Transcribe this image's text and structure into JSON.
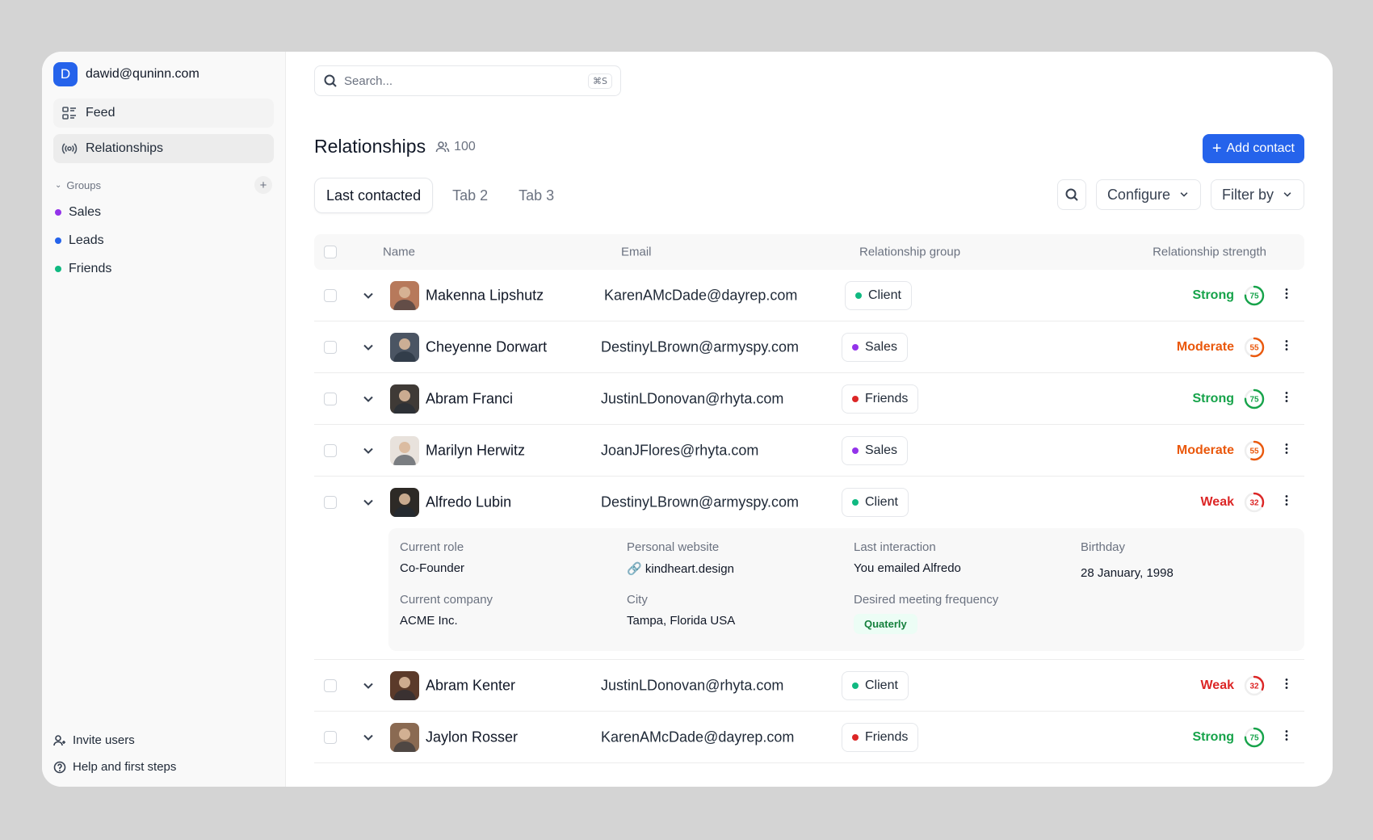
{
  "account": {
    "initial": "D",
    "email": "dawid@quninn.com"
  },
  "nav": [
    {
      "label": "Feed",
      "icon": "feed-icon"
    },
    {
      "label": "Relationships",
      "icon": "broadcast-icon"
    }
  ],
  "groups": {
    "title": "Groups",
    "items": [
      {
        "label": "Sales",
        "color": "#9333ea"
      },
      {
        "label": "Leads",
        "color": "#2563eb"
      },
      {
        "label": "Friends",
        "color": "#10b981"
      }
    ]
  },
  "footer": {
    "invite": "Invite users",
    "help": "Help and first steps"
  },
  "search": {
    "placeholder": "Search...",
    "shortcut": "⌘S"
  },
  "page": {
    "title": "Relationships",
    "count": "100",
    "add_button": "Add contact"
  },
  "tabs": [
    "Last contacted",
    "Tab 2",
    "Tab 3"
  ],
  "toolbar": {
    "configure": "Configure",
    "filter": "Filter by"
  },
  "columns": {
    "name": "Name",
    "email": "Email",
    "group": "Relationship group",
    "strength": "Relationship strength"
  },
  "colors": {
    "accent": "#2563eb",
    "strong": "#16a34a",
    "moderate": "#ea580c",
    "weak": "#dc2626"
  },
  "rows": [
    {
      "name": "Makenna Lipshutz",
      "email": "KarenAMcDade@dayrep.com",
      "group": "Client",
      "group_color": "#10b981",
      "strength": "Strong",
      "score": "75",
      "level": 0.75,
      "color": "#16a34a"
    },
    {
      "name": "Cheyenne Dorwart",
      "email": "DestinyLBrown@armyspy.com",
      "group": "Sales",
      "group_color": "#9333ea",
      "strength": "Moderate",
      "score": "55",
      "level": 0.55,
      "color": "#ea580c"
    },
    {
      "name": "Abram Franci",
      "email": "JustinLDonovan@rhyta.com",
      "group": "Friends",
      "group_color": "#dc2626",
      "strength": "Strong",
      "score": "75",
      "level": 0.75,
      "color": "#16a34a"
    },
    {
      "name": "Marilyn Herwitz",
      "email": "JoanJFlores@rhyta.com",
      "group": "Sales",
      "group_color": "#9333ea",
      "strength": "Moderate",
      "score": "55",
      "level": 0.55,
      "color": "#ea580c"
    },
    {
      "name": "Alfredo Lubin",
      "email": "DestinyLBrown@armyspy.com",
      "group": "Client",
      "group_color": "#10b981",
      "strength": "Weak",
      "score": "32",
      "level": 0.32,
      "color": "#dc2626"
    },
    {
      "name": "Abram Kenter",
      "email": "JustinLDonovan@rhyta.com",
      "group": "Client",
      "group_color": "#10b981",
      "strength": "Weak",
      "score": "32",
      "level": 0.32,
      "color": "#dc2626"
    },
    {
      "name": "Jaylon Rosser",
      "email": "KarenAMcDade@dayrep.com",
      "group": "Friends",
      "group_color": "#dc2626",
      "strength": "Strong",
      "score": "75",
      "level": 0.75,
      "color": "#16a34a"
    }
  ],
  "details": {
    "current_role_label": "Current role",
    "current_role": "Co-Founder",
    "website_label": "Personal website",
    "website": "kindheart.design",
    "last_interaction_label": "Last interaction",
    "last_interaction": "You emailed Alfredo",
    "birthday_label": "Birthday",
    "birthday": "28 January, 1998",
    "company_label": "Current company",
    "company": "ACME Inc.",
    "city_label": "City",
    "city": "Tampa, Florida USA",
    "frequency_label": "Desired meeting frequency",
    "frequency": "Quaterly"
  }
}
